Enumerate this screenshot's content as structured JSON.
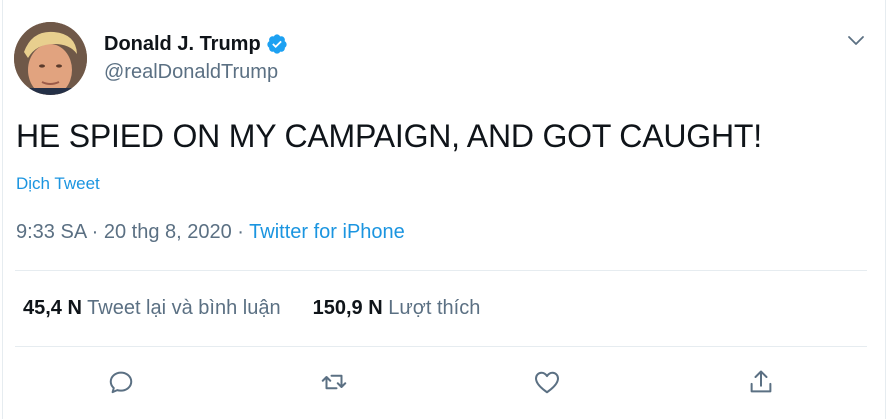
{
  "tweet": {
    "author_name": "Donald J. Trump",
    "handle": "@realDonaldTrump",
    "text": "HE SPIED ON MY CAMPAIGN, AND GOT CAUGHT!",
    "translate_label": "Dịch Tweet",
    "time": "9:33 SA",
    "date": "20 thg 8, 2020",
    "separator": " · ",
    "source": "Twitter for iPhone"
  },
  "stats": {
    "retweets_count": "45,4 N",
    "retweets_label": "Tweet lại và bình luận",
    "likes_count": "150,9 N",
    "likes_label": "Lượt thích"
  },
  "icons": {
    "verified": "verified-badge-icon",
    "caret": "chevron-down-icon",
    "reply": "reply-icon",
    "retweet": "retweet-icon",
    "like": "heart-icon",
    "share": "share-icon"
  },
  "colors": {
    "accent": "#1b95e0",
    "verified": "#1da1f2",
    "muted": "#5b7083",
    "text": "#0f1419",
    "border": "#e6ecf0"
  }
}
